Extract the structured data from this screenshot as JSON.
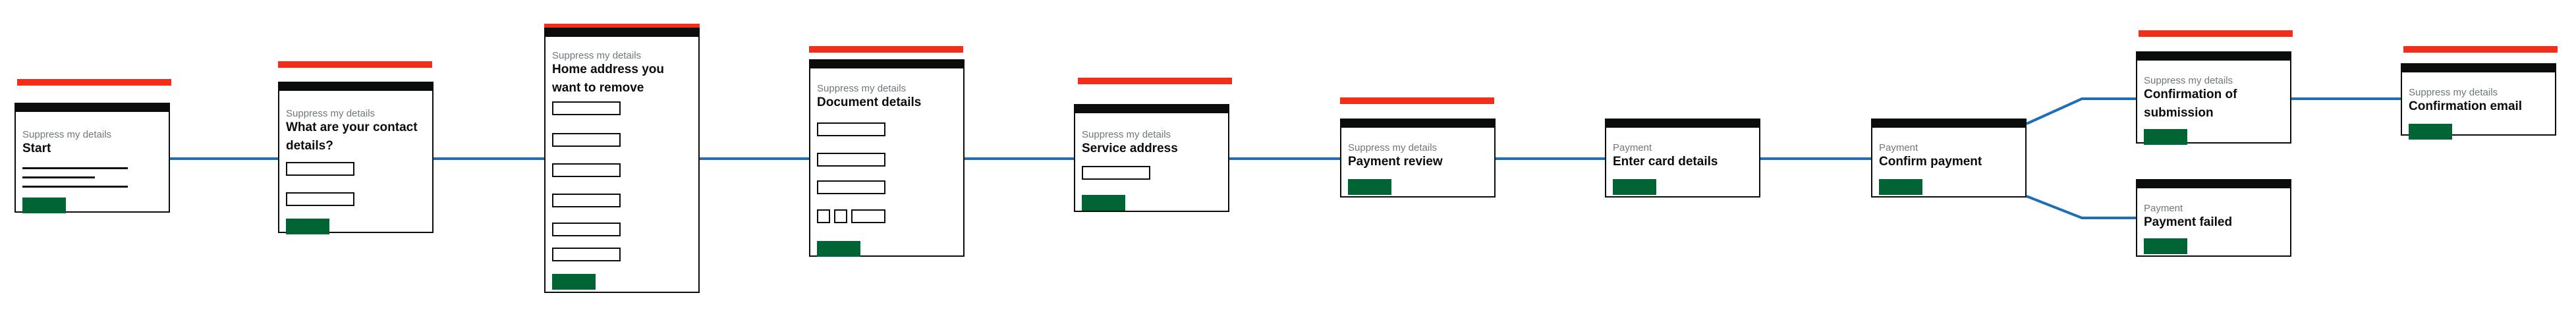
{
  "flow": {
    "screens": [
      {
        "id": "start",
        "caption": "Suppress my details",
        "title": "Start"
      },
      {
        "id": "contact-details",
        "caption": "Suppress my details",
        "title": "What are your contact details?"
      },
      {
        "id": "home-address",
        "caption": "Suppress my details",
        "title": "Home address you want to remove"
      },
      {
        "id": "document-details",
        "caption": "Suppress my details",
        "title": "Document details"
      },
      {
        "id": "service-address",
        "caption": "Suppress my details",
        "title": "Service address"
      },
      {
        "id": "payment-review",
        "caption": "Suppress my details",
        "title": "Payment review"
      },
      {
        "id": "enter-card-details",
        "caption": "Payment",
        "title": "Enter card details"
      },
      {
        "id": "confirm-payment",
        "caption": "Payment",
        "title": "Confirm payment"
      },
      {
        "id": "confirmation-of-submission",
        "caption": "Suppress my details",
        "title": "Confirmation of submission"
      },
      {
        "id": "payment-failed",
        "caption": "Payment",
        "title": "Payment failed"
      },
      {
        "id": "confirmation-email",
        "caption": "Suppress my details",
        "title": "Confirmation email"
      }
    ]
  },
  "colors": {
    "connector": "#1d70b8",
    "header_bar": "#0b0c0c",
    "accent_red": "#f02e19",
    "button_green": "#006435",
    "caption_grey": "#6f777b"
  }
}
